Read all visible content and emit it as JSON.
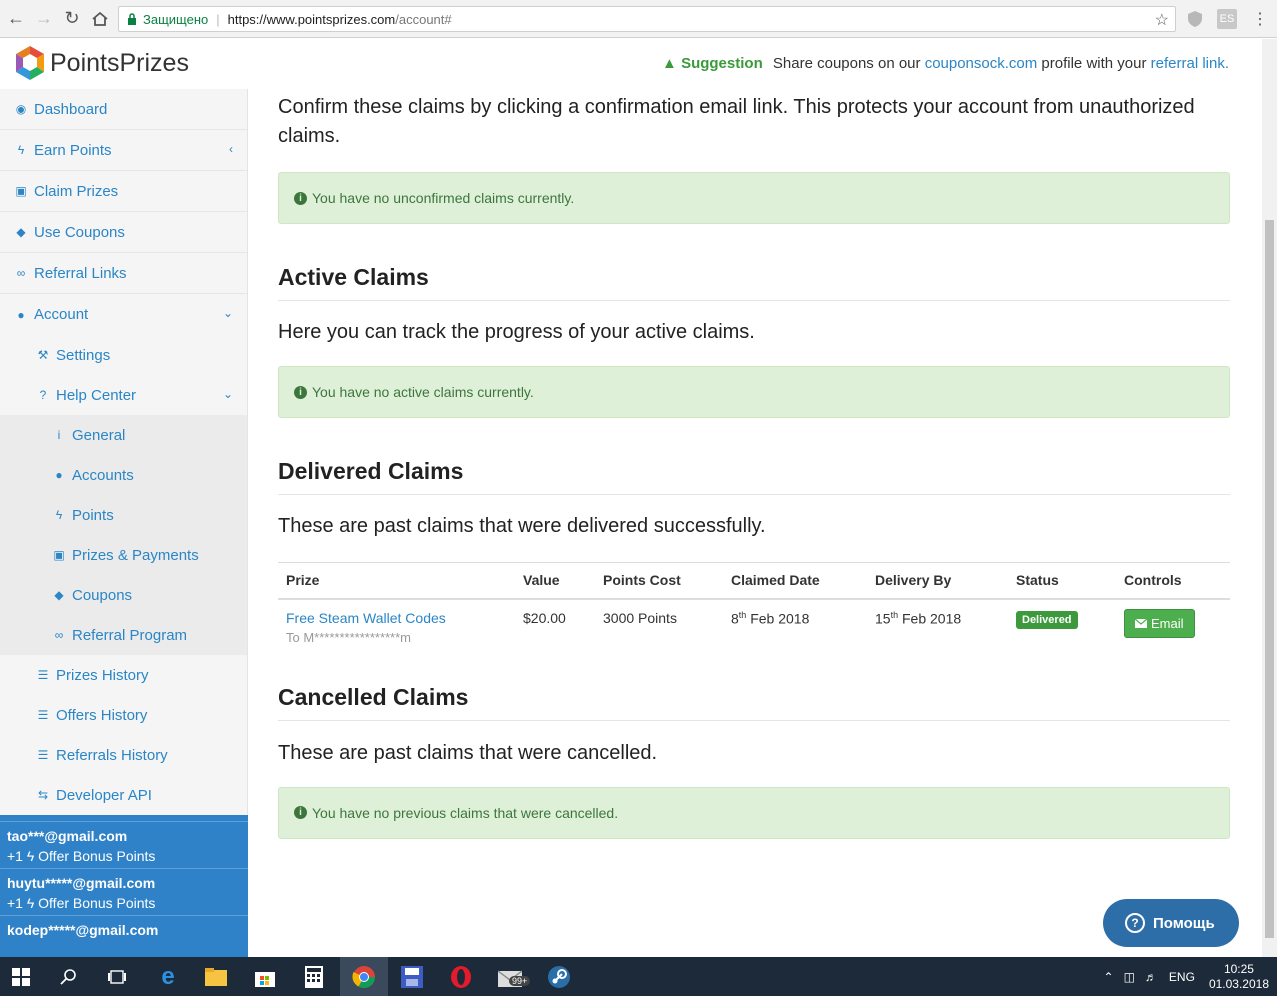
{
  "browser": {
    "secure_label": "Защищено",
    "url_host": "https://www.pointsprizes.com",
    "url_path": "/account#",
    "ext_label": "ES"
  },
  "header": {
    "logo_text": "PointsPrizes",
    "suggestion_label": "Suggestion",
    "suggestion_text_1": "Share coupons on our",
    "suggestion_link_1": "couponsock.com",
    "suggestion_text_2": "profile with your",
    "suggestion_link_2": "referral link."
  },
  "sidebar": {
    "items": [
      {
        "label": "Dashboard",
        "icon": "dashboard-icon"
      },
      {
        "label": "Earn Points",
        "icon": "bolt-icon"
      },
      {
        "label": "Claim Prizes",
        "icon": "gift-icon"
      },
      {
        "label": "Use Coupons",
        "icon": "ticket-icon"
      },
      {
        "label": "Referral Links",
        "icon": "link-icon"
      },
      {
        "label": "Account",
        "icon": "user-icon"
      }
    ],
    "account_sub": [
      {
        "label": "Settings",
        "icon": "wrench-icon"
      },
      {
        "label": "Help Center",
        "icon": "question-icon"
      }
    ],
    "help_sub": [
      {
        "label": "General",
        "icon": "info-icon"
      },
      {
        "label": "Accounts",
        "icon": "user-icon"
      },
      {
        "label": "Points",
        "icon": "bolt-icon"
      },
      {
        "label": "Prizes & Payments",
        "icon": "gift-icon"
      },
      {
        "label": "Coupons",
        "icon": "ticket-icon"
      },
      {
        "label": "Referral Program",
        "icon": "link-icon"
      }
    ],
    "history": [
      {
        "label": "Prizes History",
        "icon": "table-icon"
      },
      {
        "label": "Offers History",
        "icon": "table-icon"
      },
      {
        "label": "Referrals History",
        "icon": "table-icon"
      },
      {
        "label": "Developer API",
        "icon": "exchange-icon"
      }
    ]
  },
  "feed": [
    {
      "email": "tao***@gmail.com",
      "bonus": "+1 ϟ Offer Bonus Points"
    },
    {
      "email": "huytu*****@gmail.com",
      "bonus": "+1 ϟ Offer Bonus Points"
    },
    {
      "email": "kodep*****@gmail.com",
      "bonus": ""
    }
  ],
  "main": {
    "intro": "Confirm these claims by clicking a confirmation email link. This protects your account from unauthorized claims.",
    "unconfirmed_alert": "You have no unconfirmed claims currently.",
    "active_title": "Active Claims",
    "active_desc": "Here you can track the progress of your active claims.",
    "active_alert": "You have no active claims currently.",
    "delivered_title": "Delivered Claims",
    "delivered_desc": "These are past claims that were delivered successfully.",
    "table": {
      "headers": [
        "Prize",
        "Value",
        "Points Cost",
        "Claimed Date",
        "Delivery By",
        "Status",
        "Controls"
      ],
      "rows": [
        {
          "prize": "Free Steam Wallet Codes",
          "to": "To M*****************m",
          "value": "$20.00",
          "points": "3000 Points",
          "claimed_day": "8",
          "claimed_suffix": "th",
          "claimed_rest": "Feb 2018",
          "delivery_day": "15",
          "delivery_suffix": "th",
          "delivery_rest": "Feb 2018",
          "status": "Delivered",
          "control": "Email"
        }
      ]
    },
    "cancelled_title": "Cancelled Claims",
    "cancelled_desc": "These are past claims that were cancelled.",
    "cancelled_alert": "You have no previous claims that were cancelled."
  },
  "help_button": "Помощь",
  "taskbar": {
    "badge": "99+",
    "lang": "ENG",
    "time": "10:25",
    "date": "01.03.2018"
  },
  "colors": {
    "link": "#2a86c6",
    "alert_bg": "#dff0d8",
    "alert_text": "#3c763d",
    "delivered_badge": "#3c9a3c",
    "feed_bg": "#2f82c8",
    "help_bg": "#2e6ea8"
  }
}
